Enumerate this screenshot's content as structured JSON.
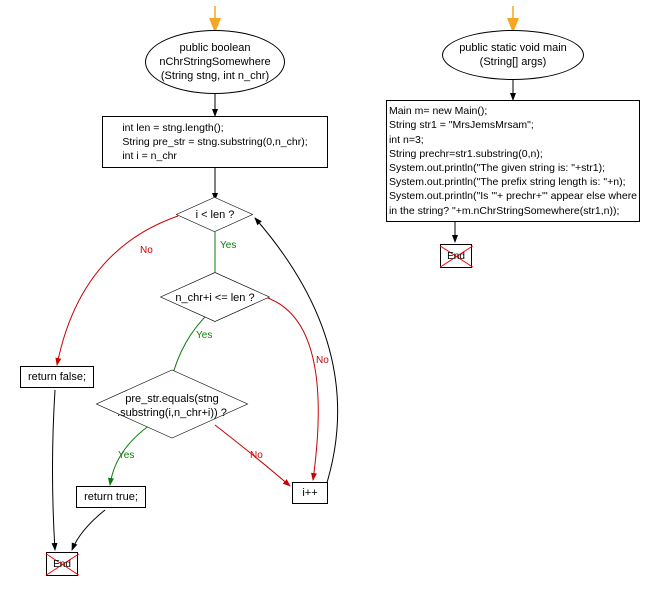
{
  "chart_data": {
    "type": "flowchart",
    "functions": [
      {
        "name": "nChrStringSomewhere",
        "nodes": {
          "start": "public boolean\nnChrStringSomewhere\n(String stng, int n_chr)",
          "init": "int len = stng.length();\nString pre_str = stng.substring(0,n_chr);\nint i = n_chr",
          "cond1": "i < len ?",
          "cond2": "n_chr+i <= len ?",
          "cond3": "pre_str.equals(stng\n.substring(i,n_chr+i)) ?",
          "ret_false": "return false;",
          "ret_true": "return true;",
          "inc": "i++",
          "end": "End"
        },
        "edges": [
          {
            "from": "start",
            "to": "init"
          },
          {
            "from": "init",
            "to": "cond1"
          },
          {
            "from": "cond1",
            "to": "cond2",
            "label": "Yes"
          },
          {
            "from": "cond1",
            "to": "ret_false",
            "label": "No"
          },
          {
            "from": "cond2",
            "to": "cond3",
            "label": "Yes"
          },
          {
            "from": "cond2",
            "to": "inc",
            "label": "No"
          },
          {
            "from": "cond3",
            "to": "ret_true",
            "label": "Yes"
          },
          {
            "from": "cond3",
            "to": "inc",
            "label": "No"
          },
          {
            "from": "inc",
            "to": "cond1"
          },
          {
            "from": "ret_false",
            "to": "end"
          },
          {
            "from": "ret_true",
            "to": "end"
          }
        ]
      },
      {
        "name": "main",
        "nodes": {
          "start": "public static void main\n(String[] args)",
          "body": "Main m= new Main();\nString str1 = \"MrsJemsMrsam\";\nint n=3;\nString prechr=str1.substring(0,n);\nSystem.out.println(\"The given string is: \"+str1);\nSystem.out.println(\"The prefix string length is: \"+n);\nSystem.out.println(\"Is '\"+ prechr+\"' appear else where\nin the string? \"+m.nChrStringSomewhere(str1,n));",
          "end": "End"
        },
        "edges": [
          {
            "from": "start",
            "to": "body"
          },
          {
            "from": "body",
            "to": "end"
          }
        ]
      }
    ]
  },
  "labels": {
    "yes": "Yes",
    "no": "No"
  }
}
